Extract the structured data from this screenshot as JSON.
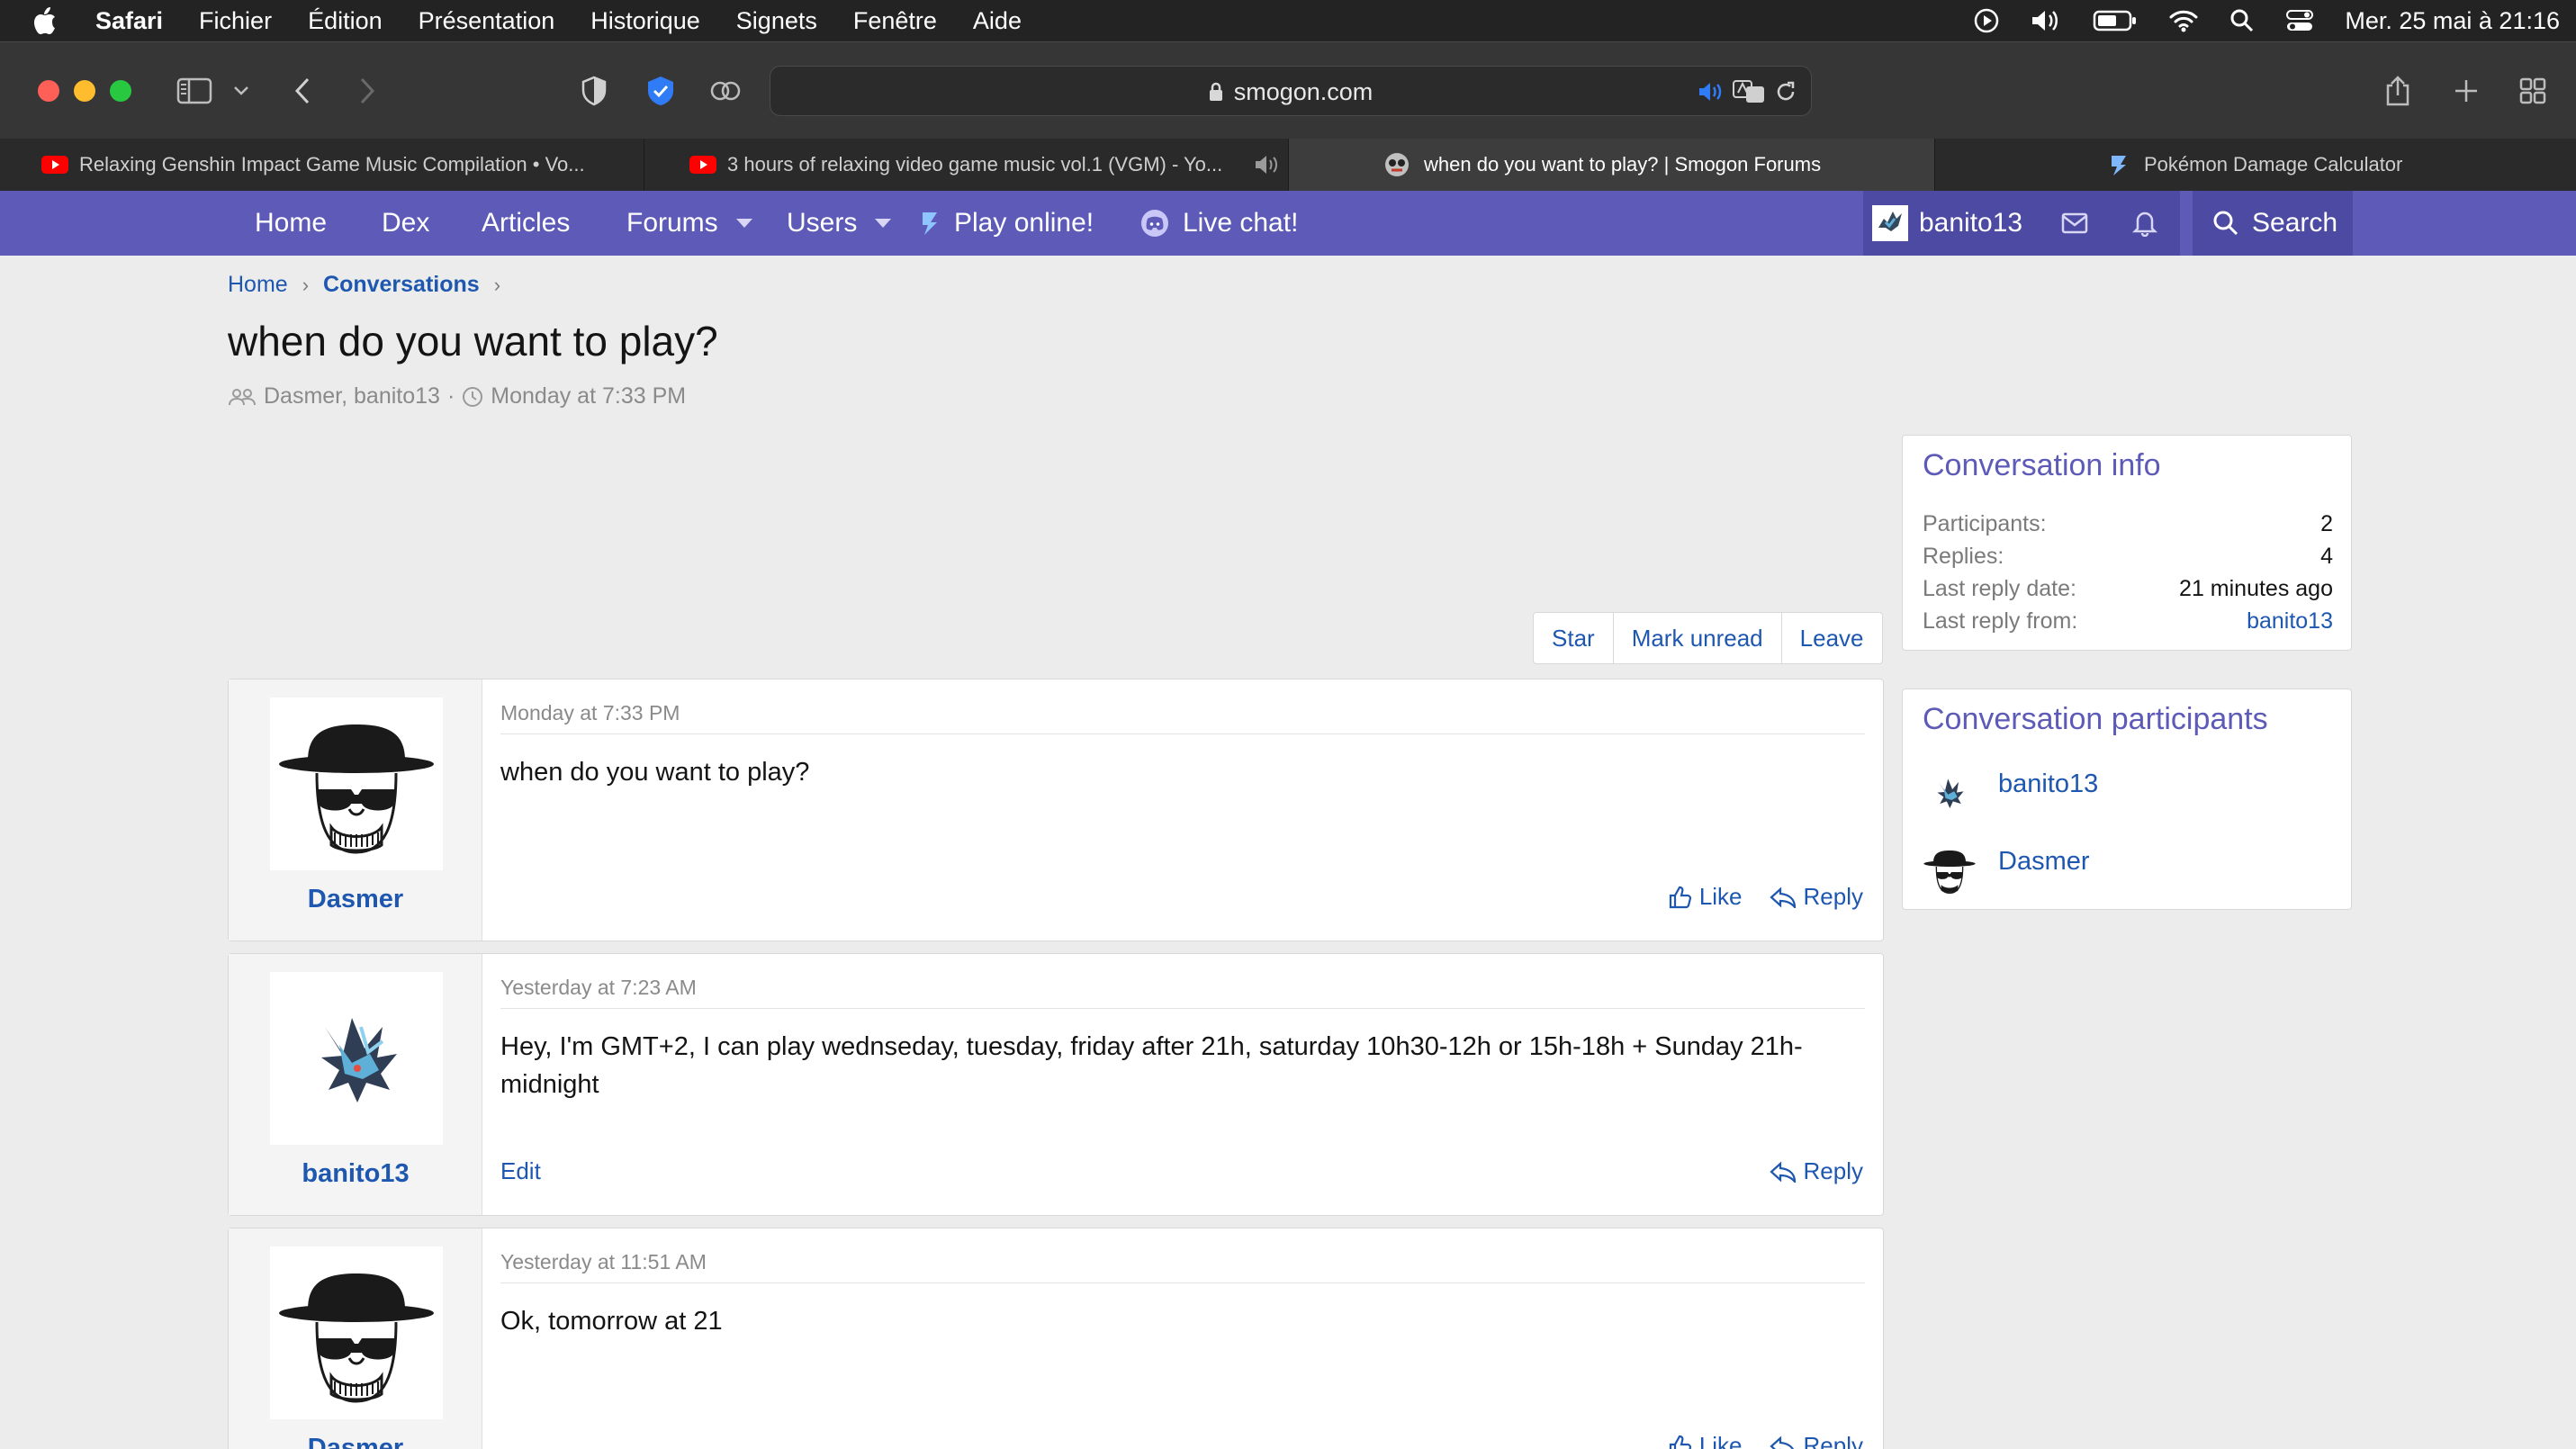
{
  "menubar": {
    "items": [
      "Safari",
      "Fichier",
      "Édition",
      "Présentation",
      "Historique",
      "Signets",
      "Fenêtre",
      "Aide"
    ],
    "clock": "Mer. 25 mai à  21:16"
  },
  "browser": {
    "url": "smogon.com",
    "tabs": [
      {
        "title": "Relaxing Genshin Impact Game Music Compilation • Vo...",
        "icon": "youtube-icon"
      },
      {
        "title": "3 hours of relaxing video game music vol.1 (VGM) - Yo...",
        "icon": "youtube-icon"
      },
      {
        "title": "when do you want to play? | Smogon Forums",
        "icon": "smogon-icon"
      },
      {
        "title": "Pokémon Damage Calculator",
        "icon": "smogon-icon"
      }
    ]
  },
  "nav": {
    "home": "Home",
    "dex": "Dex",
    "articles": "Articles",
    "forums": "Forums",
    "users": "Users",
    "play": "Play online!",
    "chat": "Live chat!",
    "username": "banito13",
    "search": "Search"
  },
  "breadcrumb": {
    "home": "Home",
    "current": "Conversations"
  },
  "page": {
    "title": "when do you want to play?",
    "participants": "Dasmer, banito13",
    "started": "Monday at 7:33 PM"
  },
  "actions": {
    "star": "Star",
    "mark_unread": "Mark unread",
    "leave": "Leave"
  },
  "messages": [
    {
      "author": "Dasmer",
      "date": "Monday at 7:33 PM",
      "body": "when do you want to play?",
      "like": "Like",
      "reply": "Reply"
    },
    {
      "author": "banito13",
      "date": "Yesterday at 7:23 AM",
      "body": "Hey, I'm GMT+2, I can play wednseday, tuesday, friday after 21h, saturday 10h30-12h or 15h-18h + Sunday 21h-midnight",
      "edit": "Edit",
      "reply": "Reply"
    },
    {
      "author": "Dasmer",
      "date": "Yesterday at 11:51 AM",
      "body": "Ok, tomorrow at 21",
      "like": "Like",
      "reply": "Reply"
    }
  ],
  "info": {
    "title": "Conversation info",
    "rows": [
      {
        "label": "Participants:",
        "value": "2"
      },
      {
        "label": "Replies:",
        "value": "4"
      },
      {
        "label": "Last reply date:",
        "value": "21 minutes ago"
      },
      {
        "label": "Last reply from:",
        "value": "banito13"
      }
    ]
  },
  "participants": {
    "title": "Conversation participants",
    "list": [
      "banito13",
      "Dasmer"
    ]
  },
  "colors": {
    "nav": "#5d5ab8",
    "link": "#1e57b0",
    "heading": "#5d5ab8"
  }
}
